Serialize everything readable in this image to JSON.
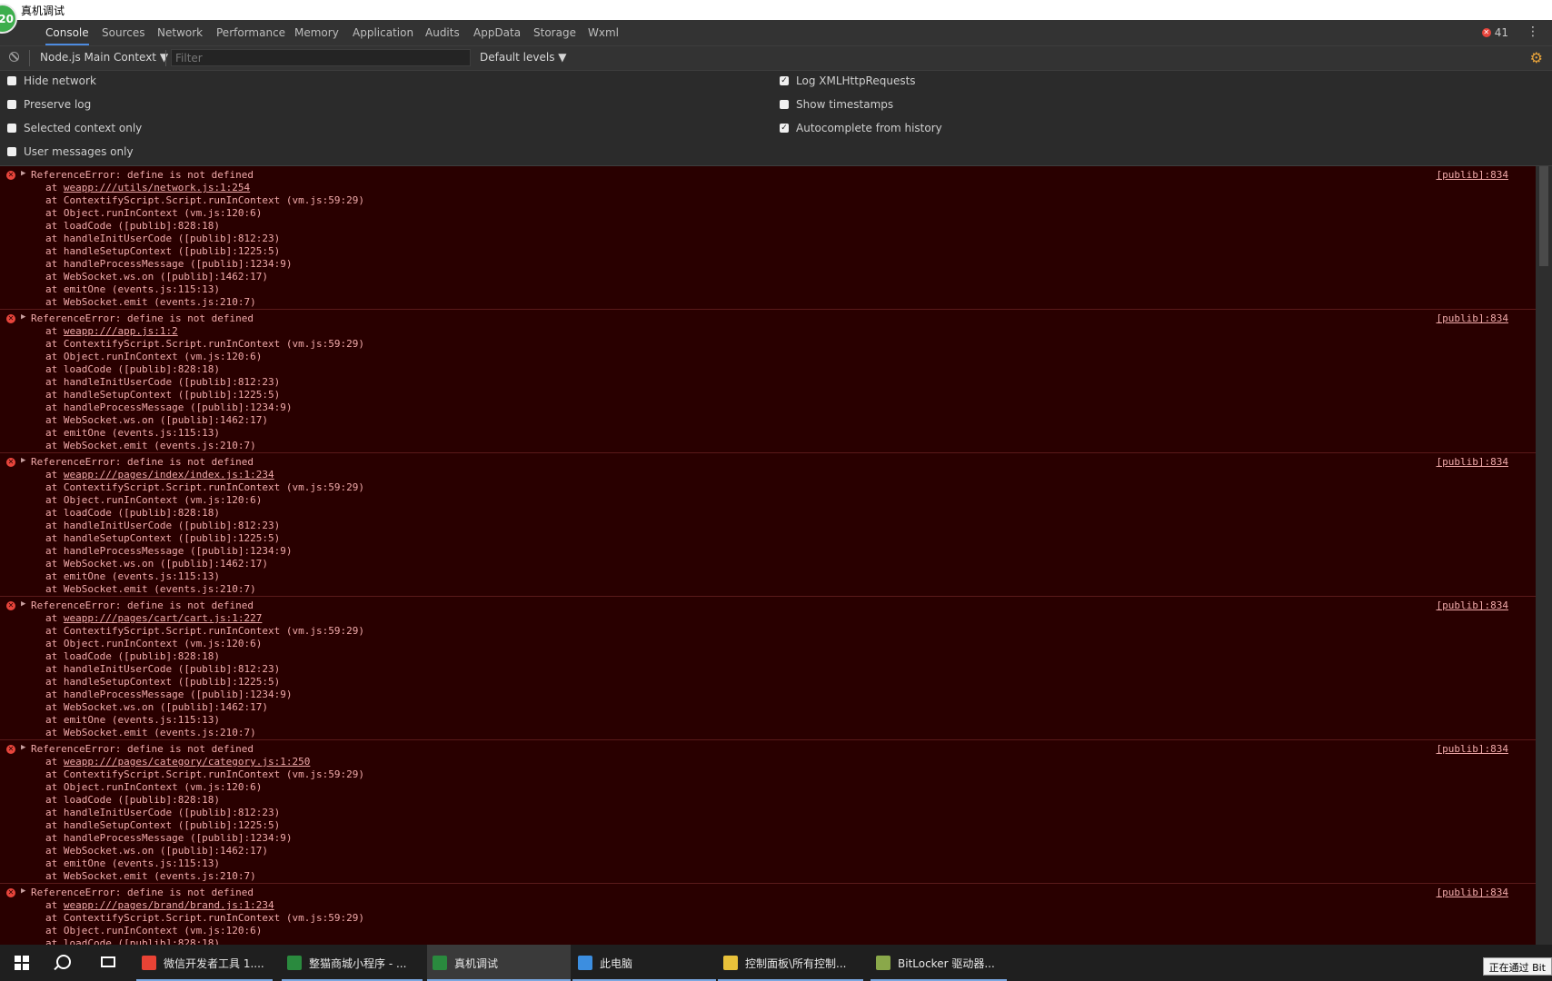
{
  "window": {
    "title": "真机调试",
    "avatar_text": "20"
  },
  "tabs": [
    "Console",
    "Sources",
    "Network",
    "Performance",
    "Memory",
    "Application",
    "Audits",
    "AppData",
    "Storage",
    "Wxml"
  ],
  "error_count": "41",
  "toolbar": {
    "context": "Node.js Main Context",
    "filter_placeholder": "Filter",
    "levels": "Default levels"
  },
  "settings": {
    "left": [
      {
        "label": "Hide network",
        "checked": false
      },
      {
        "label": "Preserve log",
        "checked": false
      },
      {
        "label": "Selected context only",
        "checked": false
      },
      {
        "label": "User messages only",
        "checked": false
      }
    ],
    "right": [
      {
        "label": "Log XMLHttpRequests",
        "checked": true
      },
      {
        "label": "Show timestamps",
        "checked": false
      },
      {
        "label": "Autocomplete from history",
        "checked": true
      }
    ]
  },
  "messages": [
    {
      "head": "ReferenceError: define is not defined",
      "source": "[publib]:834",
      "link": "weapp:///utils/network.js:1:254"
    },
    {
      "head": "ReferenceError: define is not defined",
      "source": "[publib]:834",
      "link": "weapp:///app.js:1:2"
    },
    {
      "head": "ReferenceError: define is not defined",
      "source": "[publib]:834",
      "link": "weapp:///pages/index/index.js:1:234"
    },
    {
      "head": "ReferenceError: define is not defined",
      "source": "[publib]:834",
      "link": "weapp:///pages/cart/cart.js:1:227"
    },
    {
      "head": "ReferenceError: define is not defined",
      "source": "[publib]:834",
      "link": "weapp:///pages/category/category.js:1:250"
    },
    {
      "head": "ReferenceError: define is not defined",
      "source": "[publib]:834",
      "link": "weapp:///pages/brand/brand.js:1:234"
    }
  ],
  "stack_frames": [
    "at ContextifyScript.Script.runInContext (vm.js:59:29)",
    "at Object.runInContext (vm.js:120:6)",
    "at loadCode ([publib]:828:18)",
    "at handleInitUserCode ([publib]:812:23)",
    "at handleSetupContext ([publib]:1225:5)",
    "at handleProcessMessage ([publib]:1234:9)",
    "at WebSocket.ws.on ([publib]:1462:17)",
    "at emitOne (events.js:115:13)",
    "at WebSocket.emit (events.js:210:7)"
  ],
  "frame_prefix": "at ",
  "taskbar": [
    {
      "label": "微信开发者工具 1....",
      "color": "#e94335"
    },
    {
      "label": "整猫商城小程序 - ...",
      "color": "#2a8a3e"
    },
    {
      "label": "真机调试",
      "color": "#2a8a3e"
    },
    {
      "label": "此电脑",
      "color": "#3c8ee0"
    },
    {
      "label": "控制面板\\所有控制...",
      "color": "#e8c13a"
    },
    {
      "label": "BitLocker 驱动器...",
      "color": "#8aa84a"
    }
  ],
  "tray_tip": "正在通过 Bit"
}
